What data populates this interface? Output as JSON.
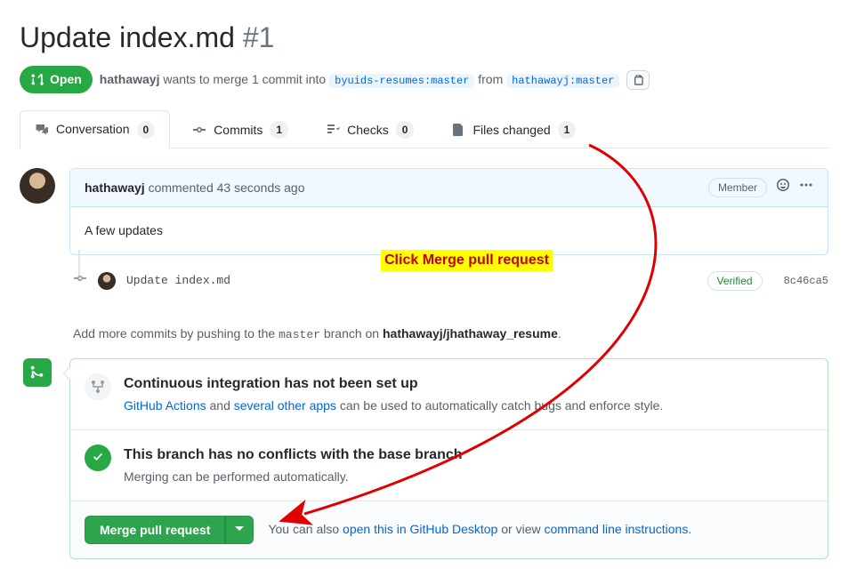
{
  "title": "Update index.md",
  "pr_number": "#1",
  "state": {
    "label": "Open"
  },
  "author": "hathawayj",
  "meta": {
    "wants_text": "wants to merge 1 commit into",
    "from_text": "from",
    "base_branch": "byuids-resumes:master",
    "head_branch": "hathawayj:master"
  },
  "tabs": {
    "conversation": {
      "label": "Conversation",
      "count": "0"
    },
    "commits": {
      "label": "Commits",
      "count": "1"
    },
    "checks": {
      "label": "Checks",
      "count": "0"
    },
    "files": {
      "label": "Files changed",
      "count": "1"
    }
  },
  "comment": {
    "user": "hathawayj",
    "action_text": "commented",
    "time": "43 seconds ago",
    "member_label": "Member",
    "body": "A few updates"
  },
  "commit": {
    "message": "Update index.md",
    "verified_label": "Verified",
    "sha": "8c46ca5"
  },
  "annotation": "Click Merge pull request",
  "push_hint": {
    "pre": "Add more commits by pushing to the",
    "branch": "master",
    "mid": "branch on",
    "repo": "hathawayj/jhathaway_resume",
    "end": "."
  },
  "ci": {
    "title": "Continuous integration has not been set up",
    "link1": "GitHub Actions",
    "and": " and ",
    "link2": "several other apps",
    "tail": " can be used to automatically catch bugs and enforce style."
  },
  "conflicts": {
    "title": "This branch has no conflicts with the base branch",
    "sub": "Merging can be performed automatically."
  },
  "merge": {
    "button": "Merge pull request",
    "footer_pre": "You can also ",
    "link1": "open this in GitHub Desktop",
    "mid": " or view ",
    "link2": "command line instructions",
    "end": "."
  }
}
